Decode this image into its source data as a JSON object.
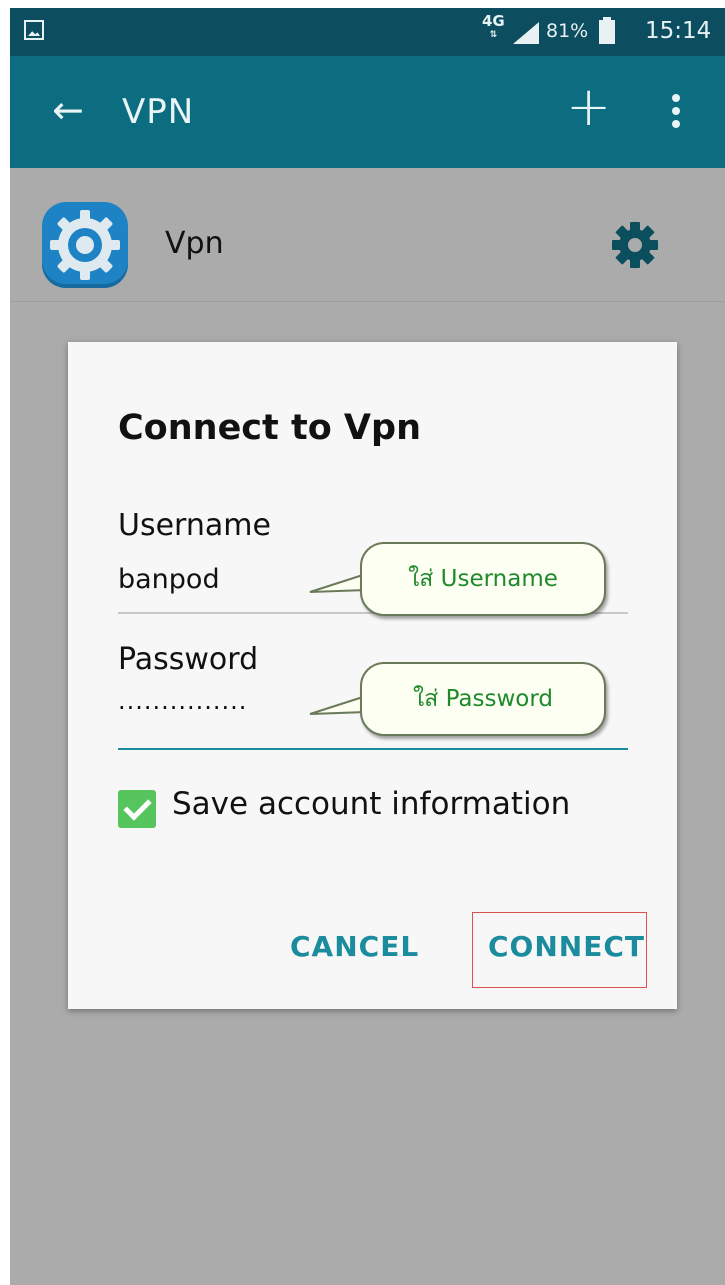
{
  "status_bar": {
    "network": "4G",
    "network_sub": "⇅",
    "battery_percent": "81%",
    "time": "15:14",
    "icons": [
      "gallery-icon",
      "signal-icon",
      "battery-icon"
    ]
  },
  "app_bar": {
    "title": "VPN",
    "back_icon": "back-arrow-icon",
    "add_icon": "plus-icon",
    "more_icon": "overflow-menu-icon",
    "color": "#0b6d7f"
  },
  "vpn_list": [
    {
      "name": "Vpn",
      "icon": "vpn-app-gear-icon",
      "action_icon": "gear-icon"
    }
  ],
  "dialog": {
    "title": "Connect to Vpn",
    "username_label": "Username",
    "username_value": "banpod",
    "password_label": "Password",
    "password_value": "···············",
    "save_label": "Save account information",
    "save_checked": true,
    "cancel_label": "CANCEL",
    "connect_label": "CONNECT",
    "accent": "#1b8b9e"
  },
  "annotations": {
    "username_hint": "ใส่ Username",
    "password_hint": "ใส่ Password",
    "highlight_color": "#d9534f"
  }
}
